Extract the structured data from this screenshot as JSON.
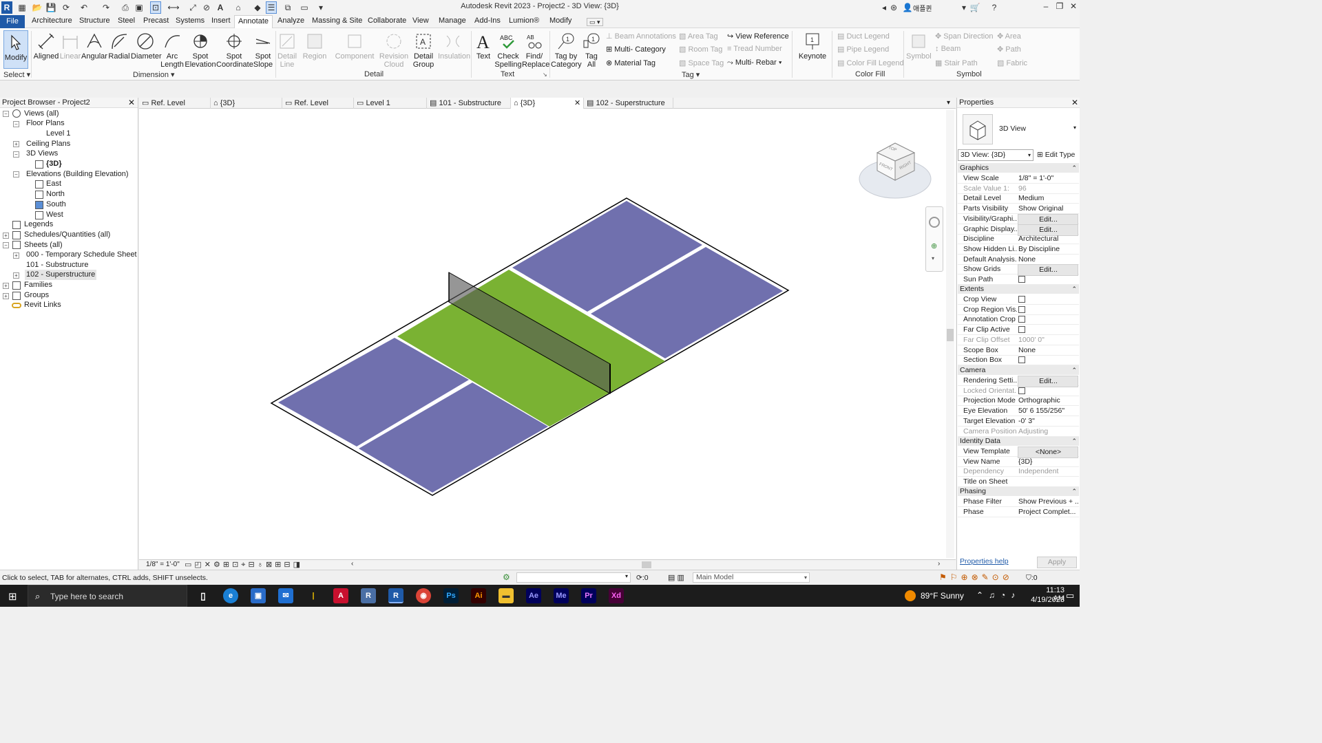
{
  "window": {
    "title": "Autodesk Revit 2023 - Project2 - 3D View: {3D}",
    "user": "애플퀸"
  },
  "menu": {
    "file": "File",
    "tabs": [
      "Architecture",
      "Structure",
      "Steel",
      "Precast",
      "Systems",
      "Insert",
      "Annotate",
      "Analyze",
      "Massing & Site",
      "Collaborate",
      "View",
      "Manage",
      "Add-Ins",
      "Lumion®",
      "Modify"
    ],
    "active": "Annotate"
  },
  "ribbon": {
    "select": {
      "modify": "Modify",
      "panel": "Select"
    },
    "dimension": {
      "items": [
        "Aligned",
        "Linear",
        "Angular",
        "Radial",
        "Diameter",
        "Arc Length",
        "Spot Elevation",
        "Spot Coordinate",
        "Spot Slope"
      ],
      "panel": "Dimension"
    },
    "detail": {
      "items": [
        "Detail Line",
        "Region",
        "Component",
        "Revision Cloud",
        "Detail Group",
        "Insulation"
      ],
      "panel": "Detail"
    },
    "text": {
      "items": [
        "Text",
        "Check Spelling",
        "Find/ Replace"
      ],
      "panel": "Text"
    },
    "tag": {
      "tag_by_category": "Tag by Category",
      "tag_all": "Tag All",
      "col1": [
        "Beam Annotations",
        "Multi- Category",
        "Material Tag"
      ],
      "col2": [
        "Area Tag",
        "Room Tag",
        "Space Tag"
      ],
      "col3": [
        "View Reference",
        "Tread Number",
        "Multi- Rebar"
      ],
      "keynote": "Keynote",
      "panel": "Tag"
    },
    "colorfill": {
      "items": [
        "Duct Legend",
        "Pipe Legend",
        "Color Fill Legend"
      ],
      "panel": "Color Fill"
    },
    "symbol": {
      "symbol": "Symbol",
      "col1": [
        "Span Direction",
        "Beam",
        "Stair Path"
      ],
      "col2": [
        "Area",
        "Path",
        "Fabric"
      ],
      "panel": "Symbol"
    }
  },
  "project_browser": {
    "title": "Project Browser - Project2",
    "items": [
      "Views (all)",
      "Floor Plans",
      "Level 1",
      "Ceiling Plans",
      "3D Views",
      "{3D}",
      "Elevations (Building Elevation)",
      "East",
      "North",
      "South",
      "West",
      "Legends",
      "Schedules/Quantities (all)",
      "Sheets (all)",
      "000 - Temporary Schedule Sheet",
      "101 - Substructure",
      "102 - Superstructure",
      "Families",
      "Groups",
      "Revit Links"
    ]
  },
  "view_tabs": [
    "Ref. Level",
    "{3D}",
    "Ref. Level",
    "Level 1",
    "101 - Substructure",
    "{3D}",
    "102 - Superstructure"
  ],
  "viewcube": {
    "top": "TOP",
    "front": "FRONT",
    "right": "RIGHT"
  },
  "view_bar": {
    "scale": "1/8\" = 1'-0\""
  },
  "properties": {
    "title": "Properties",
    "type_name": "3D View",
    "selector": "3D View: {3D}",
    "edit_type": "Edit Type",
    "groups": {
      "graphics": "Graphics",
      "extents": "Extents",
      "camera": "Camera",
      "identity": "Identity Data",
      "phasing": "Phasing"
    },
    "graphics_rows": [
      {
        "label": "View Scale",
        "value": "1/8\" = 1'-0\""
      },
      {
        "label": "Scale Value    1:",
        "value": "96"
      },
      {
        "label": "Detail Level",
        "value": "Medium"
      },
      {
        "label": "Parts Visibility",
        "value": "Show Original"
      },
      {
        "label": "Visibility/Graphi...",
        "value": "Edit..."
      },
      {
        "label": "Graphic Display...",
        "value": "Edit..."
      },
      {
        "label": "Discipline",
        "value": "Architectural"
      },
      {
        "label": "Show Hidden Li...",
        "value": "By Discipline"
      },
      {
        "label": "Default Analysis...",
        "value": "None"
      },
      {
        "label": "Show Grids",
        "value": "Edit..."
      },
      {
        "label": "Sun Path",
        "value": ""
      }
    ],
    "extents_rows": [
      {
        "label": "Crop View",
        "value": ""
      },
      {
        "label": "Crop Region Vis...",
        "value": ""
      },
      {
        "label": "Annotation Crop",
        "value": ""
      },
      {
        "label": "Far Clip Active",
        "value": ""
      },
      {
        "label": "Far Clip Offset",
        "value": "1000'  0\""
      },
      {
        "label": "Scope Box",
        "value": "None"
      },
      {
        "label": "Section Box",
        "value": ""
      }
    ],
    "camera_rows": [
      {
        "label": "Rendering Setti...",
        "value": "Edit..."
      },
      {
        "label": "Locked Orientat...",
        "value": ""
      },
      {
        "label": "Projection Mode",
        "value": "Orthographic"
      },
      {
        "label": "Eye Elevation",
        "value": "50'  6 155/256\""
      },
      {
        "label": "Target Elevation",
        "value": "-0'  3\""
      },
      {
        "label": "Camera Position",
        "value": "Adjusting"
      }
    ],
    "identity_rows": [
      {
        "label": "View Template",
        "value": "<None>"
      },
      {
        "label": "View Name",
        "value": "{3D}"
      },
      {
        "label": "Dependency",
        "value": "Independent"
      },
      {
        "label": "Title on Sheet",
        "value": ""
      }
    ],
    "phasing_rows": [
      {
        "label": "Phase Filter",
        "value": "Show Previous + ..."
      },
      {
        "label": "Phase",
        "value": "Project Complet..."
      }
    ],
    "help": "Properties help",
    "apply": "Apply"
  },
  "status": {
    "message": "Click to select, TAB for alternates, CTRL adds, SHIFT unselects.",
    "zero": ":0",
    "model": "Main Model",
    "filter": ":0"
  },
  "taskbar": {
    "search": "Type here to search",
    "weather": "89°F  Sunny",
    "time": "11:13 AM",
    "date": "4/19/2023"
  },
  "colors": {
    "court_blue": "#7070ae",
    "kitchen_green": "#7ab233",
    "file_blue": "#1f5aa8",
    "taskbar": "#1c1c1c"
  }
}
